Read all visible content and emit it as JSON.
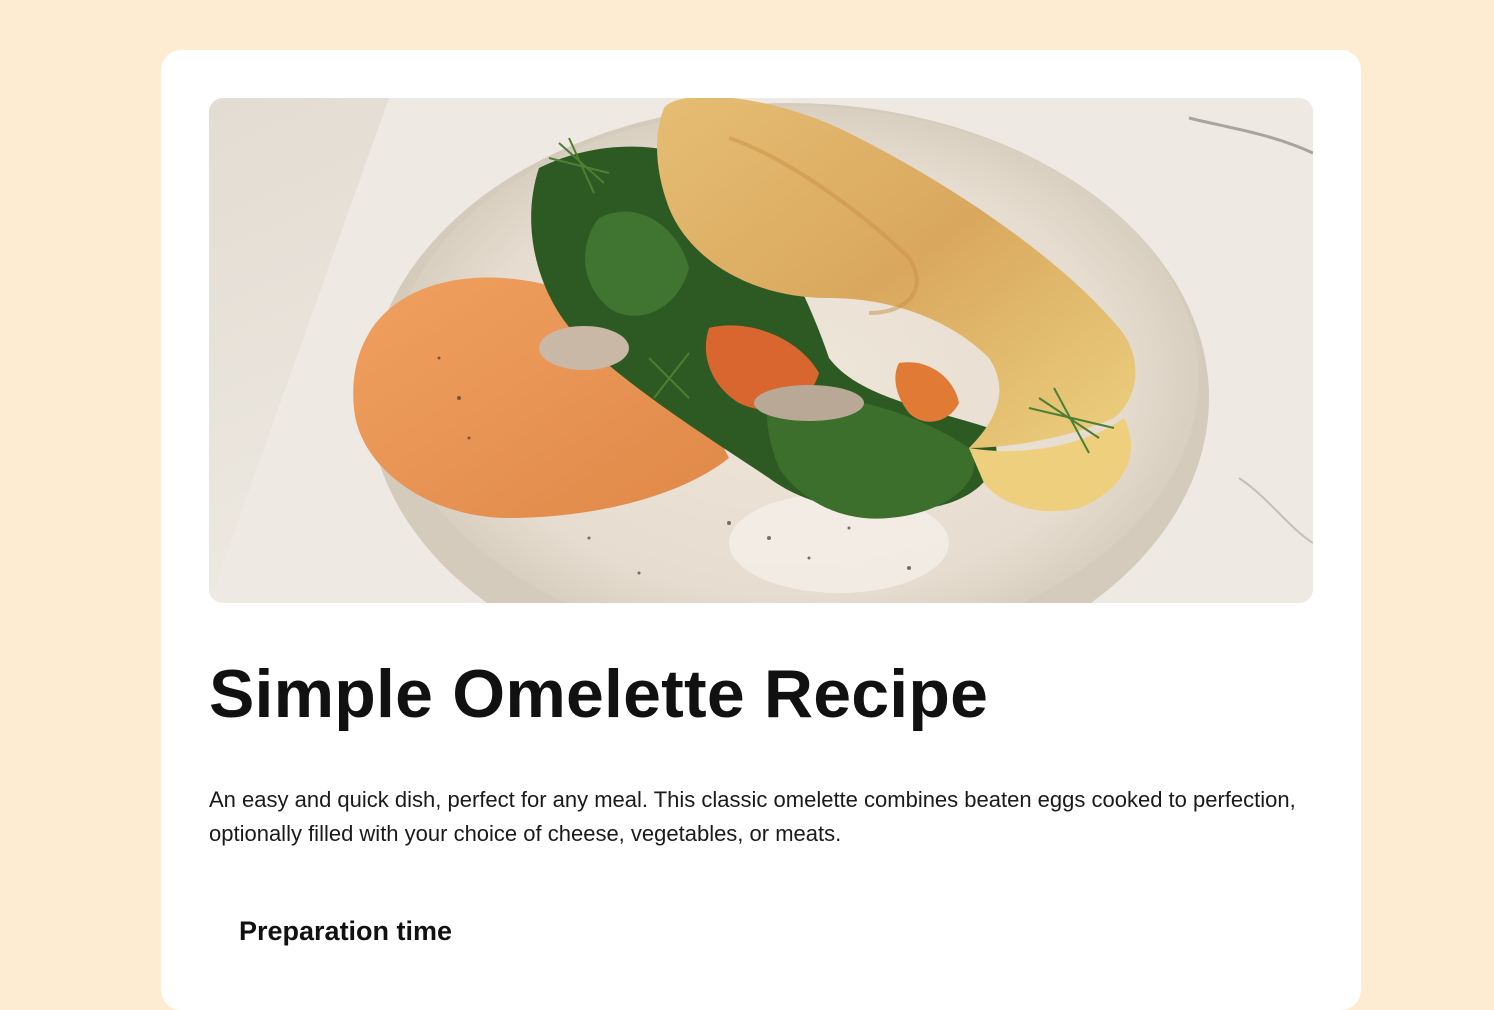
{
  "recipe": {
    "image_description": "",
    "title": "Simple Omelette Recipe",
    "description": "An easy and quick dish, perfect for any meal. This classic omelette combines beaten eggs cooked to perfection, optionally filled with your choice of cheese, vegetables, or meats.",
    "preparation_heading": "Preparation time"
  },
  "colors": {
    "page_background": "#fdebd2",
    "card_background": "#ffffff",
    "text": "#111111"
  }
}
